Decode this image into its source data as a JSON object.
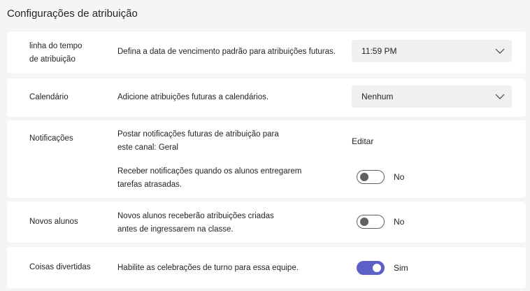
{
  "page": {
    "title": "Configurações de atribuição"
  },
  "timeline": {
    "label_line1": "linha do tempo",
    "label_line2": "de atribuição",
    "description": "Defina a data de vencimento padrão para atribuições futuras.",
    "selected_value": "11:59 PM"
  },
  "calendar": {
    "label": "Calendário",
    "description": "Adicione atribuições futuras a calendários.",
    "selected_value": "Nenhum"
  },
  "notifications": {
    "label": "Notificações",
    "post_line1": "Postar notificações futuras de atribuição para",
    "post_line2": "este canal: Geral",
    "edit_label": "Editar",
    "late_line1": "Receber notificações quando os alunos entregarem",
    "late_line2": "tarefas atrasadas.",
    "late_toggle_on": false,
    "late_toggle_text": "No"
  },
  "new_students": {
    "label": "Novos alunos",
    "desc_line1": "Novos alunos receberão atribuições criadas",
    "desc_line2": "antes de ingressarem na classe.",
    "toggle_on": false,
    "toggle_text": "No"
  },
  "fun_stuff": {
    "label": "Coisas divertidas",
    "description": "Habilite as celebrações de turno para essa equipe.",
    "toggle_on": true,
    "toggle_text": "Sim"
  },
  "colors": {
    "toggle_on": "#5b5fc7",
    "toggle_off_border": "#616161",
    "page_background": "#f5f5f5"
  },
  "icons": {
    "dropdown": "chevron-down-icon"
  }
}
